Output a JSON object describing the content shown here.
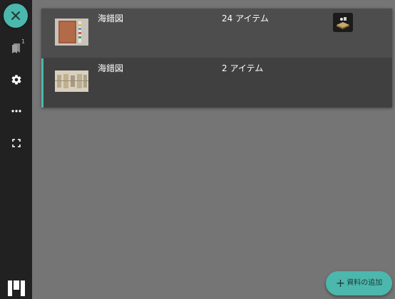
{
  "sidebar": {
    "close_icon": "close-icon",
    "items": [
      {
        "icon": "bookmark-icon",
        "badge": "1"
      },
      {
        "icon": "gear-icon"
      },
      {
        "icon": "more-horizontal-icon"
      },
      {
        "icon": "fullscreen-icon"
      }
    ],
    "logo_icon": "mirador-logo-icon"
  },
  "resources": [
    {
      "title": "海錯図",
      "count": "24 アイテム",
      "thumbnail": "book-cover-thumbnail",
      "provider_icon": "provider-logo-icon",
      "selected": false
    },
    {
      "title": "海錯図",
      "count": "2 アイテム",
      "thumbnail": "scroll-thumbnail",
      "selected": true
    }
  ],
  "add_button": {
    "icon": "plus-icon",
    "label": "資料の追加"
  },
  "colors": {
    "accent": "#4cb7ad",
    "sidebar": "#212121",
    "background": "#757575",
    "panel": "#424242"
  }
}
